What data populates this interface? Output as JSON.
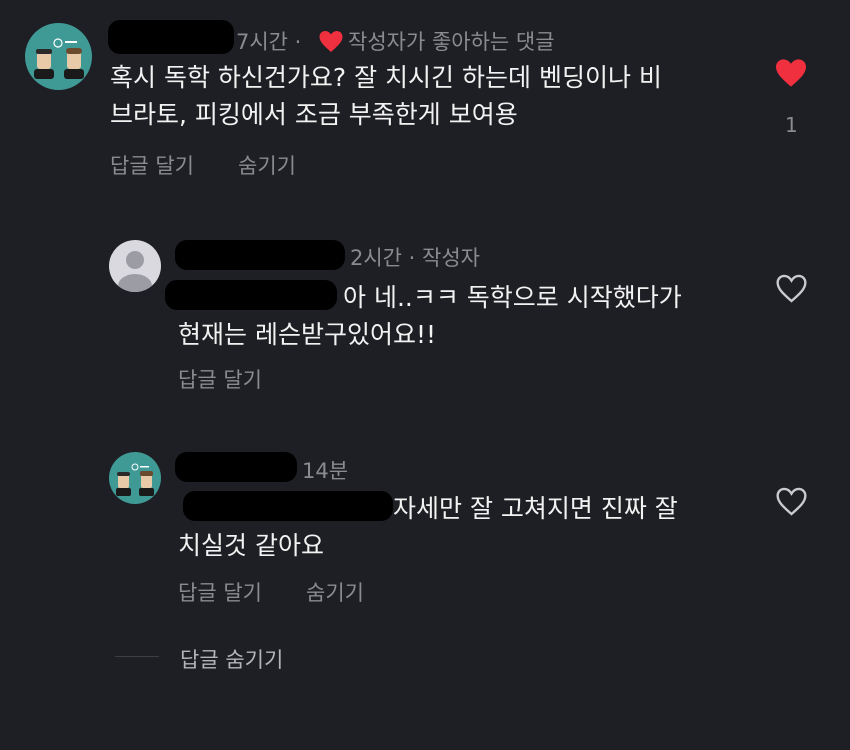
{
  "comment1": {
    "time": "7시간 ·",
    "liked_by_author": "작성자가 좋아하는 댓글",
    "text_line1": "혹시 독학 하신건가요? 잘 치시긴 하는데 벤딩이나 비",
    "text_line2": "브라토, 피킹에서 조금 부족한게 보여용",
    "reply_label": "답글 달기",
    "hide_label": "숨기기",
    "like_count": "1"
  },
  "reply1": {
    "time": "2시간 · 작성자",
    "text_line1": "아 네..ㅋㅋ 독학으로 시작했다가",
    "text_line2": "현재는 레슨받구있어요!!",
    "reply_label": "답글 달기"
  },
  "reply2": {
    "time": "14분",
    "text_line1": "자세만 잘 고쳐지면 진짜 잘",
    "text_line2": "치실것 같아요",
    "reply_label": "답글 달기",
    "hide_label": "숨기기"
  },
  "footer": {
    "hide_replies_label": "답글 숨기기"
  },
  "colors": {
    "background": "#1e1f24",
    "heart_active": "#f0303e",
    "muted_text": "#8a8b91"
  }
}
